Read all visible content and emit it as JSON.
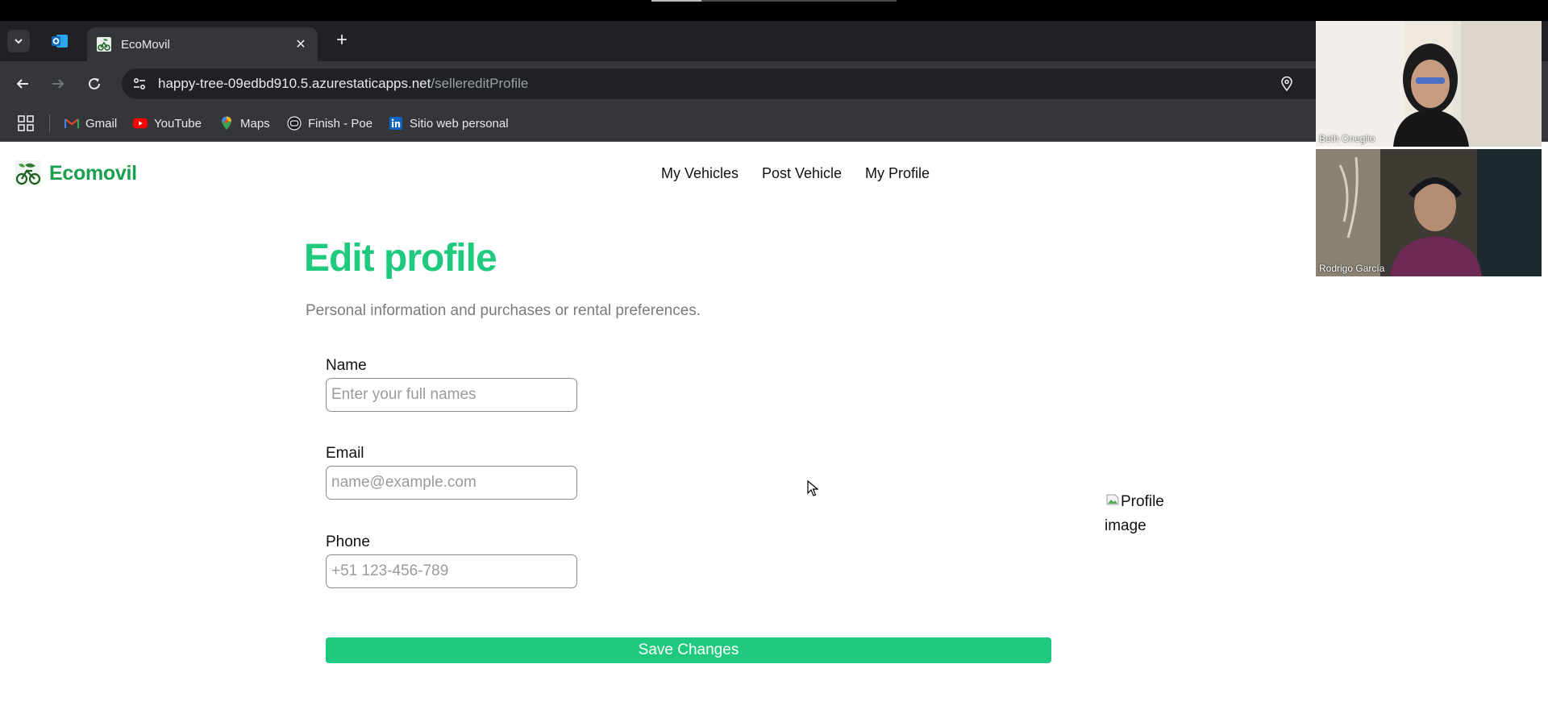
{
  "browser": {
    "tab": {
      "title": "EcoMovil"
    },
    "url": {
      "host": "happy-tree-09edbd910.5.azurestaticapps.net",
      "path": "/sellereditProfile"
    },
    "bookmarks": [
      {
        "label": "Gmail",
        "icon": "gmail-icon"
      },
      {
        "label": "YouTube",
        "icon": "youtube-icon"
      },
      {
        "label": "Maps",
        "icon": "maps-icon"
      },
      {
        "label": "Finish - Poe",
        "icon": "poe-icon"
      },
      {
        "label": "Sitio web personal",
        "icon": "linkedin-icon"
      }
    ]
  },
  "site": {
    "brand": "Ecomovil",
    "nav": [
      "My Vehicles",
      "Post Vehicle",
      "My Profile"
    ]
  },
  "form": {
    "title": "Edit profile",
    "subtitle": "Personal information and purchases or rental preferences.",
    "name": {
      "label": "Name",
      "placeholder": "Enter your full names",
      "value": ""
    },
    "email": {
      "label": "Email",
      "placeholder": "name@example.com",
      "value": ""
    },
    "phone": {
      "label": "Phone",
      "placeholder": "+51 123-456-789",
      "value": ""
    },
    "save_label": "Save Changes",
    "profile_image_alt_line1": "Profile",
    "profile_image_alt_line2": "image"
  },
  "call": {
    "participants": [
      "Beth Oneglio",
      "Rodrigo García"
    ]
  },
  "colors": {
    "brand_green": "#19a04e",
    "accent_green": "#1fc97e",
    "chrome_dark": "#202124",
    "chrome_mid": "#35363a"
  }
}
